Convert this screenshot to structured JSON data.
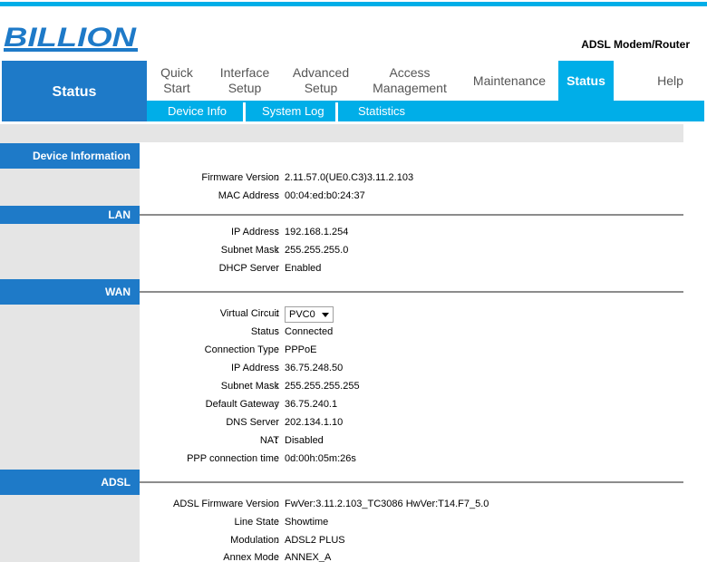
{
  "header": {
    "logo_text": "BILLION",
    "product_name": "ADSL Modem/Router"
  },
  "nav": {
    "current_section": "Status",
    "menu": [
      {
        "line1": "Quick",
        "line2": "Start"
      },
      {
        "line1": "Interface",
        "line2": "Setup"
      },
      {
        "line1": "Advanced",
        "line2": "Setup"
      },
      {
        "line1": "Access",
        "line2": "Management"
      },
      {
        "line1": "Maintenance",
        "line2": ""
      },
      {
        "line1": "Status",
        "line2": ""
      },
      {
        "line1": "Help",
        "line2": ""
      }
    ],
    "submenu": [
      "Device Info",
      "System Log",
      "Statistics"
    ]
  },
  "colors": {
    "accent_blue": "#1e7ac8",
    "accent_cyan": "#00aee8",
    "panel_gray": "#e5e5e5"
  },
  "device_info": {
    "title": "Device Information",
    "rows": [
      {
        "label": "Firmware Version",
        "value": "2.11.57.0(UE0.C3)3.11.2.103"
      },
      {
        "label": "MAC Address",
        "value": "00:04:ed:b0:24:37"
      }
    ]
  },
  "lan": {
    "title": "LAN",
    "rows": [
      {
        "label": "IP Address",
        "value": "192.168.1.254"
      },
      {
        "label": "Subnet Mask",
        "value": "255.255.255.0"
      },
      {
        "label": "DHCP Server",
        "value": "Enabled"
      }
    ]
  },
  "wan": {
    "title": "WAN",
    "virtual_circuit_label": "Virtual Circuit",
    "virtual_circuit_value": "PVC0",
    "rows": [
      {
        "label": "Status",
        "value": "Connected"
      },
      {
        "label": "Connection Type",
        "value": "PPPoE"
      },
      {
        "label": "IP Address",
        "value": "36.75.248.50"
      },
      {
        "label": "Subnet Mask",
        "value": "255.255.255.255"
      },
      {
        "label": "Default Gateway",
        "value": "36.75.240.1"
      },
      {
        "label": "DNS Server",
        "value": "202.134.1.10"
      },
      {
        "label": "NAT",
        "value": "Disabled"
      },
      {
        "label": "PPP connection time",
        "value": "0d:00h:05m:26s"
      }
    ]
  },
  "adsl": {
    "title": "ADSL",
    "rows": [
      {
        "label": "ADSL Firmware Version",
        "value": "FwVer:3.11.2.103_TC3086 HwVer:T14.F7_5.0"
      },
      {
        "label": "Line State",
        "value": "Showtime"
      },
      {
        "label": "Modulation",
        "value": "ADSL2 PLUS"
      },
      {
        "label": "Annex Mode",
        "value": "ANNEX_A"
      }
    ]
  }
}
